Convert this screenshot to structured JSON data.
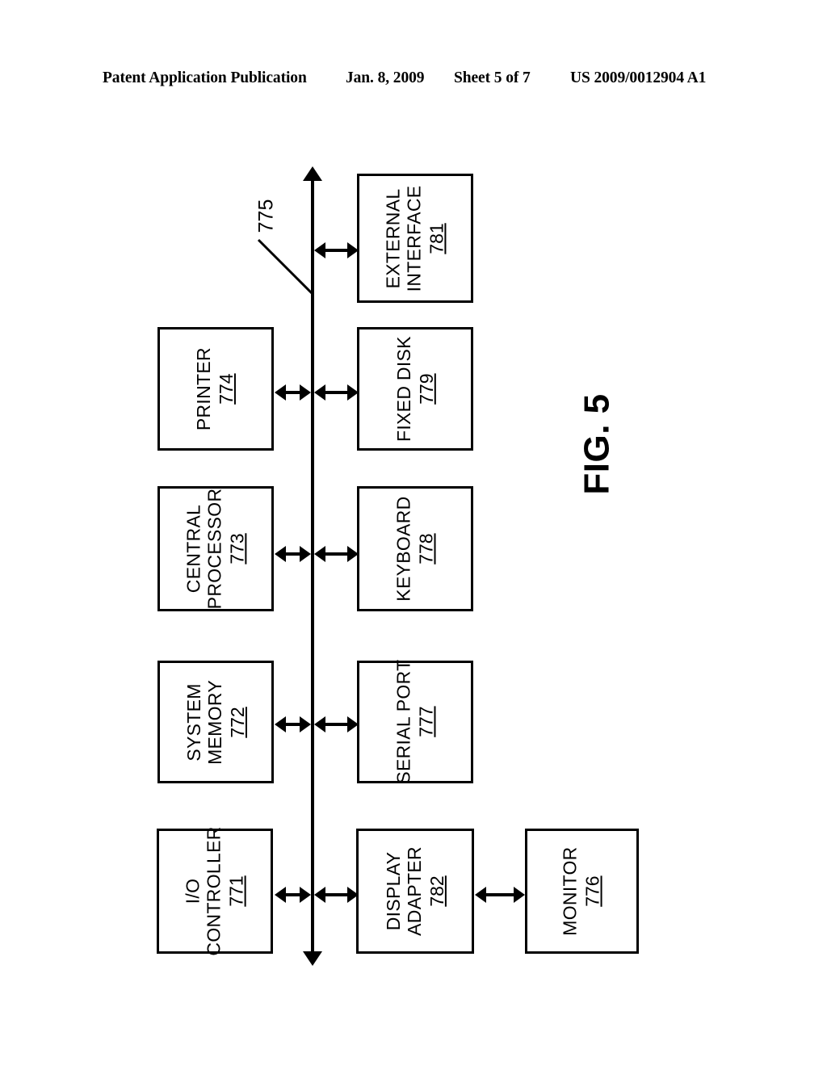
{
  "header": {
    "publication": "Patent Application Publication",
    "date": "Jan. 8, 2009",
    "sheet": "Sheet 5 of 7",
    "patent_number": "US 2009/0012904 A1"
  },
  "figure": {
    "label": "FIG. 5",
    "bus_reference": "775",
    "nodes": [
      {
        "id": "external-interface",
        "label": "EXTERNAL\nINTERFACE",
        "label_line1": "EXTERNAL",
        "label_line2": "INTERFACE",
        "ref": "781"
      },
      {
        "id": "printer",
        "label": "PRINTER",
        "label_line1": "PRINTER",
        "label_line2": "",
        "ref": "774"
      },
      {
        "id": "fixed-disk",
        "label": "FIXED DISK",
        "label_line1": "FIXED DISK",
        "label_line2": "",
        "ref": "779"
      },
      {
        "id": "central-processor",
        "label": "CENTRAL\nPROCESSOR",
        "label_line1": "CENTRAL",
        "label_line2": "PROCESSOR",
        "ref": "773"
      },
      {
        "id": "keyboard",
        "label": "KEYBOARD",
        "label_line1": "KEYBOARD",
        "label_line2": "",
        "ref": "778"
      },
      {
        "id": "system-memory",
        "label": "SYSTEM\nMEMORY",
        "label_line1": "SYSTEM",
        "label_line2": "MEMORY",
        "ref": "772"
      },
      {
        "id": "serial-port",
        "label": "SERIAL PORT",
        "label_line1": "SERIAL PORT",
        "label_line2": "",
        "ref": "777"
      },
      {
        "id": "io-controller",
        "label": "I/O\nCONTROLLER",
        "label_line1": "I/O",
        "label_line2": "CONTROLLER",
        "ref": "771"
      },
      {
        "id": "display-adapter",
        "label": "DISPLAY\nADAPTER",
        "label_line1": "DISPLAY",
        "label_line2": "ADAPTER",
        "ref": "782"
      },
      {
        "id": "monitor",
        "label": "MONITOR",
        "label_line1": "MONITOR",
        "label_line2": "",
        "ref": "776"
      }
    ],
    "connections": [
      {
        "from": "system-bus",
        "to": "external-interface",
        "type": "bidirectional"
      },
      {
        "from": "printer",
        "to": "system-bus",
        "type": "bidirectional"
      },
      {
        "from": "system-bus",
        "to": "fixed-disk",
        "type": "bidirectional"
      },
      {
        "from": "central-processor",
        "to": "system-bus",
        "type": "bidirectional"
      },
      {
        "from": "system-bus",
        "to": "keyboard",
        "type": "bidirectional"
      },
      {
        "from": "system-memory",
        "to": "system-bus",
        "type": "bidirectional"
      },
      {
        "from": "system-bus",
        "to": "serial-port",
        "type": "bidirectional"
      },
      {
        "from": "io-controller",
        "to": "system-bus",
        "type": "bidirectional"
      },
      {
        "from": "system-bus",
        "to": "display-adapter",
        "type": "bidirectional"
      },
      {
        "from": "display-adapter",
        "to": "monitor",
        "type": "bidirectional"
      }
    ]
  },
  "colors": {
    "ink": "#000000",
    "paper": "#ffffff"
  }
}
